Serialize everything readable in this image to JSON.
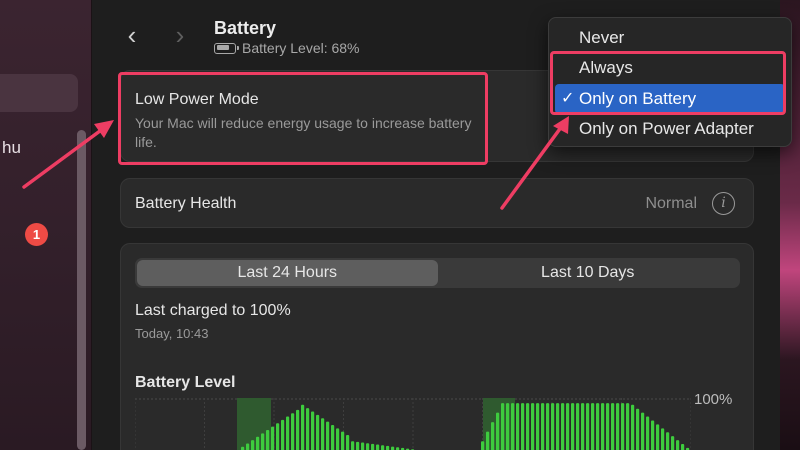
{
  "header": {
    "title": "Battery",
    "subtitle": "Battery Level: 68%"
  },
  "sidebar": {
    "partial_text": "hu",
    "badge": "1"
  },
  "low_power_mode": {
    "title": "Low Power Mode",
    "description": "Your Mac will reduce energy usage to increase battery life."
  },
  "dropdown": {
    "options": [
      {
        "label": "Never",
        "selected": false
      },
      {
        "label": "Always",
        "selected": false
      },
      {
        "label": "Only on Battery",
        "selected": true
      },
      {
        "label": "Only on Power Adapter",
        "selected": false
      }
    ],
    "check_mark": "✓"
  },
  "battery_health": {
    "label": "Battery Health",
    "value": "Normal"
  },
  "usage": {
    "tabs": [
      {
        "label": "Last 24 Hours",
        "active": true
      },
      {
        "label": "Last 10 Days",
        "active": false
      }
    ],
    "last_charged": "Last charged to 100%",
    "last_charged_time": "Today, 10:43",
    "battery_level_title": "Battery Level",
    "axis_max_label": "100%"
  },
  "colors": {
    "accent": "#2a64c5",
    "bar_green": "#3ecb3e",
    "charging_band": "#2f5a2f",
    "annotation_red": "#ee3d63",
    "badge_red": "#ee4b45"
  },
  "icons": {
    "back": "chevron-left-icon",
    "forward": "chevron-right-icon",
    "battery": "battery-icon",
    "info": "info-icon",
    "check": "checkmark-icon"
  }
}
